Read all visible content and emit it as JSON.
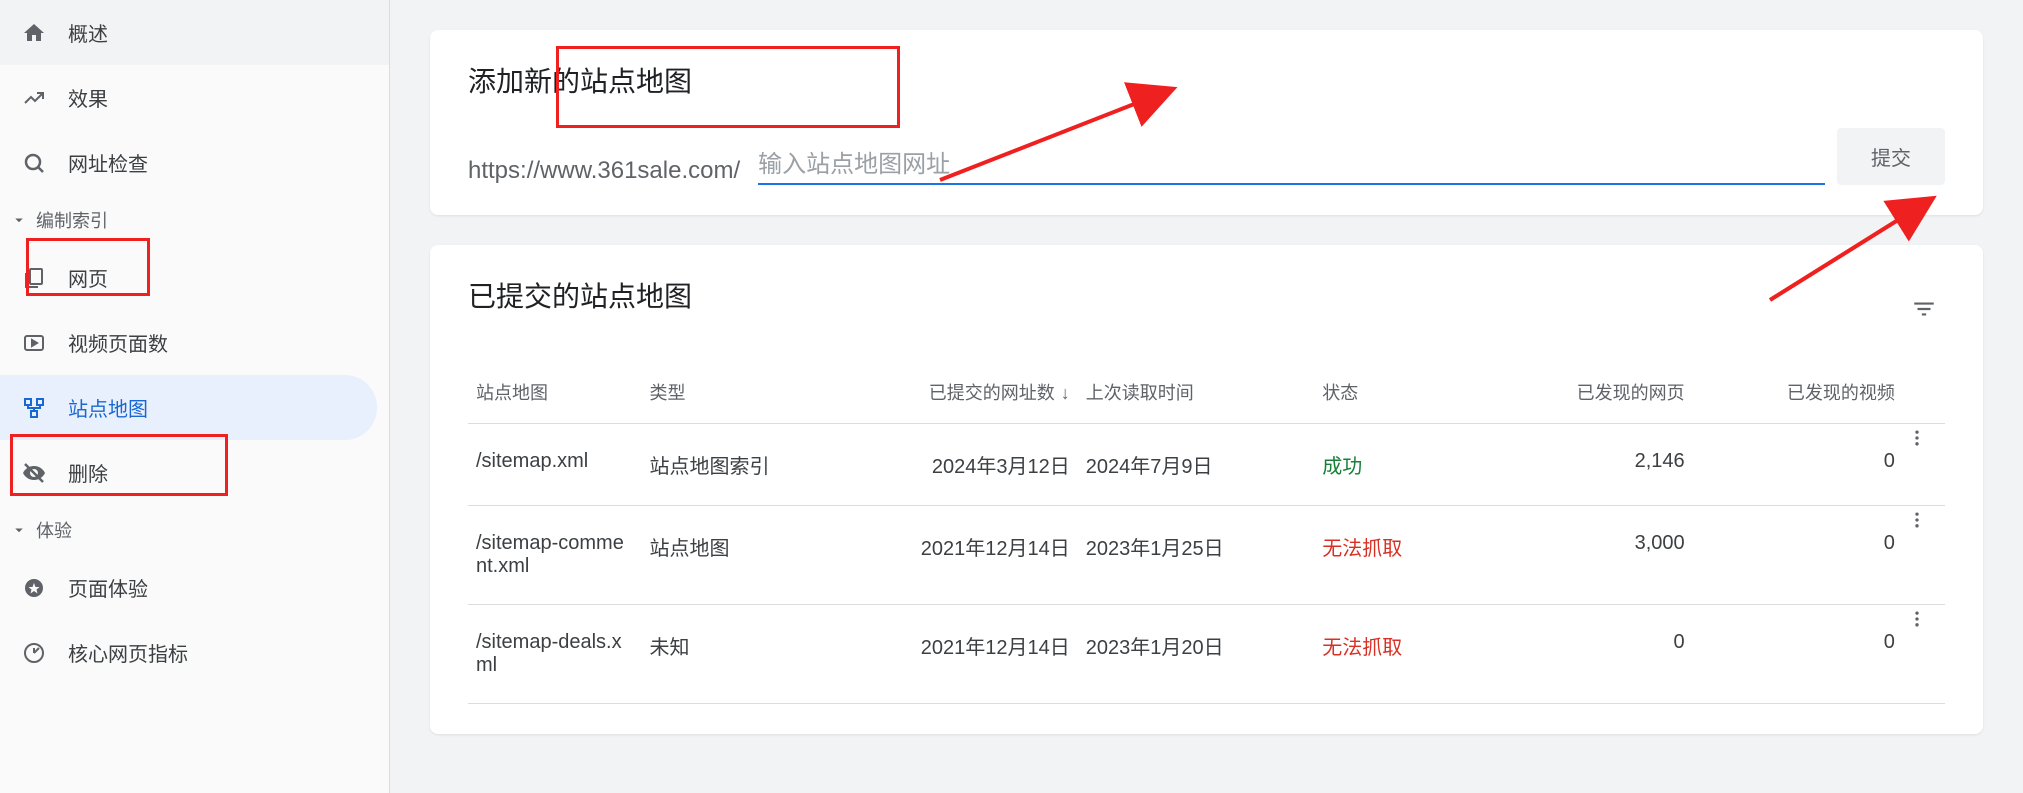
{
  "sidebar": {
    "top": [
      {
        "label": "概述",
        "icon": "home"
      },
      {
        "label": "效果",
        "icon": "performance"
      },
      {
        "label": "网址检查",
        "icon": "search"
      }
    ],
    "section_index": {
      "header": "编制索引",
      "items": [
        {
          "label": "网页",
          "icon": "pages"
        },
        {
          "label": "视频页面数",
          "icon": "video"
        },
        {
          "label": "站点地图",
          "icon": "sitemap"
        },
        {
          "label": "删除",
          "icon": "remove"
        }
      ]
    },
    "section_experience": {
      "header": "体验",
      "items": [
        {
          "label": "页面体验",
          "icon": "page-exp"
        },
        {
          "label": "核心网页指标",
          "icon": "core-web"
        }
      ]
    }
  },
  "add_sitemap": {
    "title": "添加新的站点地图",
    "url_prefix": "https://www.361sale.com/",
    "placeholder": "输入站点地图网址",
    "submit_label": "提交"
  },
  "submitted": {
    "title": "已提交的站点地图",
    "columns": {
      "sitemap": "站点地图",
      "type": "类型",
      "submitted_count": "已提交的网址数",
      "last_read": "上次读取时间",
      "status": "状态",
      "discovered_pages": "已发现的网页",
      "discovered_videos": "已发现的视频"
    },
    "rows": [
      {
        "sitemap": "/sitemap.xml",
        "type": "站点地图索引",
        "submitted": "2024年3月12日",
        "last_read": "2024年7月9日",
        "status": "成功",
        "status_class": "success",
        "pages": "2,146",
        "videos": "0"
      },
      {
        "sitemap": "/sitemap-comment.xml",
        "type": "站点地图",
        "submitted": "2021年12月14日",
        "last_read": "2023年1月25日",
        "status": "无法抓取",
        "status_class": "error",
        "pages": "3,000",
        "videos": "0"
      },
      {
        "sitemap": "/sitemap-deals.xml",
        "type": "未知",
        "submitted": "2021年12月14日",
        "last_read": "2023年1月20日",
        "status": "无法抓取",
        "status_class": "error",
        "pages": "0",
        "videos": "0"
      }
    ]
  }
}
